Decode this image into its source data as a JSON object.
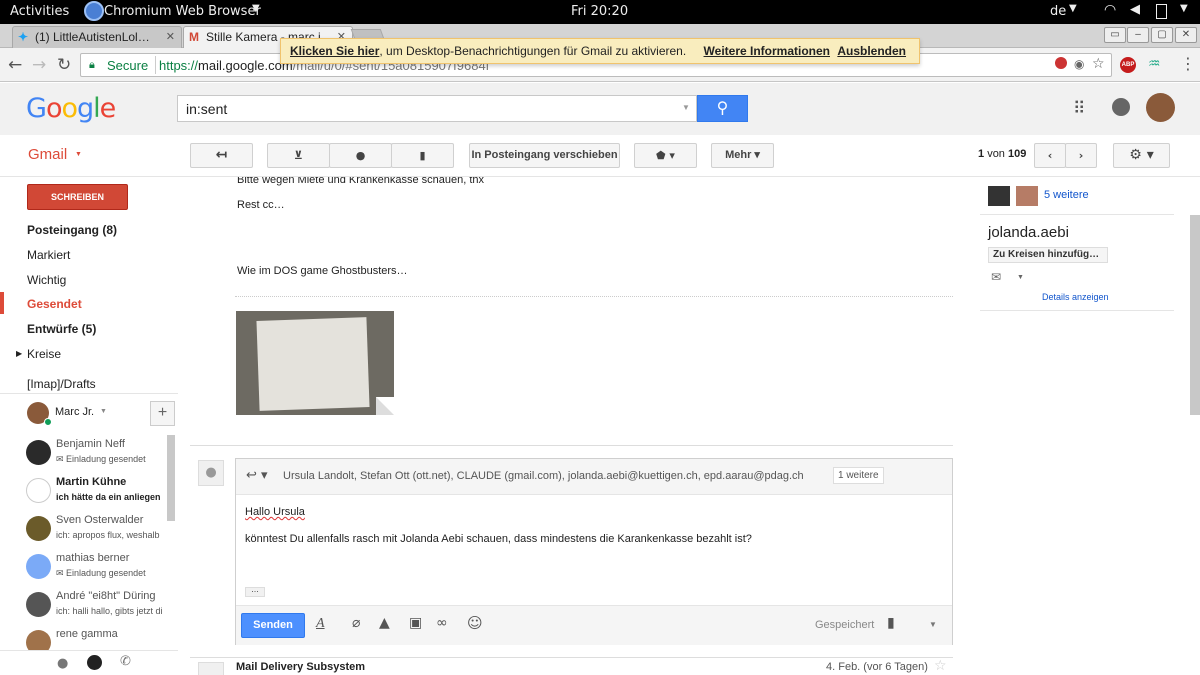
{
  "system": {
    "activities": "Activities",
    "app_name": "Chromium Web Browser",
    "clock": "Fri 20:20",
    "language": "de"
  },
  "tabs": [
    {
      "label": "(1) LittleAutistenLol…"
    },
    {
      "label": "Stille Kamera - marc.j…"
    }
  ],
  "omnibox": {
    "secure_label": "Secure",
    "url_scheme": "https://",
    "url_host": "mail.google.com",
    "url_path": "/mail/u/0/#sent/15a0815907f9684f"
  },
  "gmail": {
    "logo": "Google",
    "search_value": "in:sent",
    "product_label": "Gmail",
    "notice": {
      "link_text": "Klicken Sie hier",
      "body": ", um Desktop-Benachrichtigungen für Gmail zu aktivieren.",
      "more_info": "Weitere Informationen",
      "dismiss": "Ausblenden"
    },
    "toolbar": {
      "move_inbox": "In Posteingang verschieben",
      "more": "Mehr",
      "pager_current": "1",
      "pager_of": "von",
      "pager_total": "109"
    },
    "compose_label": "SCHREIBEN",
    "nav": [
      {
        "label": "Posteingang (8)"
      },
      {
        "label": "Markiert"
      },
      {
        "label": "Wichtig"
      },
      {
        "label": "Gesendet"
      },
      {
        "label": "Entwürfe (5)"
      },
      {
        "label": "Kreise"
      },
      {
        "label": "[Imap]/Drafts"
      }
    ],
    "me": "Marc Jr.",
    "chats": [
      {
        "name": "Benjamin Neff",
        "status": "Einladung gesendet"
      },
      {
        "name": "Martin Kühne",
        "status": "ich hätte da ein anliegen"
      },
      {
        "name": "Sven Osterwalder",
        "status": "ich: apropos flux, weshalb"
      },
      {
        "name": "mathias berner",
        "status": "Einladung gesendet"
      },
      {
        "name": "André \"ei8ht\" Düring",
        "status": "ich: halli hallo, gibts jetzt di"
      },
      {
        "name": "rene gamma",
        "status": ""
      }
    ],
    "message": {
      "line1": "Bitte wegen Miete und Krankenkasse schauen, thx",
      "line2": "Rest cc…",
      "line3": "Wie im DOS game Ghostbusters…"
    },
    "reply": {
      "recipients": "Ursula Landolt, Stefan Ott (ott.net), CLAUDE (gmail.com), jolanda.aebi@kuettigen.ch, epd.aarau@pdag.ch",
      "more_recipients": "1 weitere",
      "greeting": "Hallo Ursula",
      "body": "könntest Du allenfalls rasch mit Jolanda Aebi schauen, dass mindestens die Karankenkasse bezahlt ist?",
      "ellipsis": "…",
      "send": "Senden",
      "saved": "Gespeichert"
    },
    "next_mail": {
      "sender": "Mail Delivery Subsystem",
      "date": "4. Feb. (vor 6 Tagen)"
    },
    "side": {
      "more_people": "5 weitere",
      "contact": "jolanda.aebi",
      "add_circles": "Zu Kreisen hinzufüg…",
      "details": "Details anzeigen"
    }
  },
  "colors": {
    "gmail_red": "#d14836",
    "blue": "#4285f4",
    "notice_bg": "#f9edbe"
  }
}
